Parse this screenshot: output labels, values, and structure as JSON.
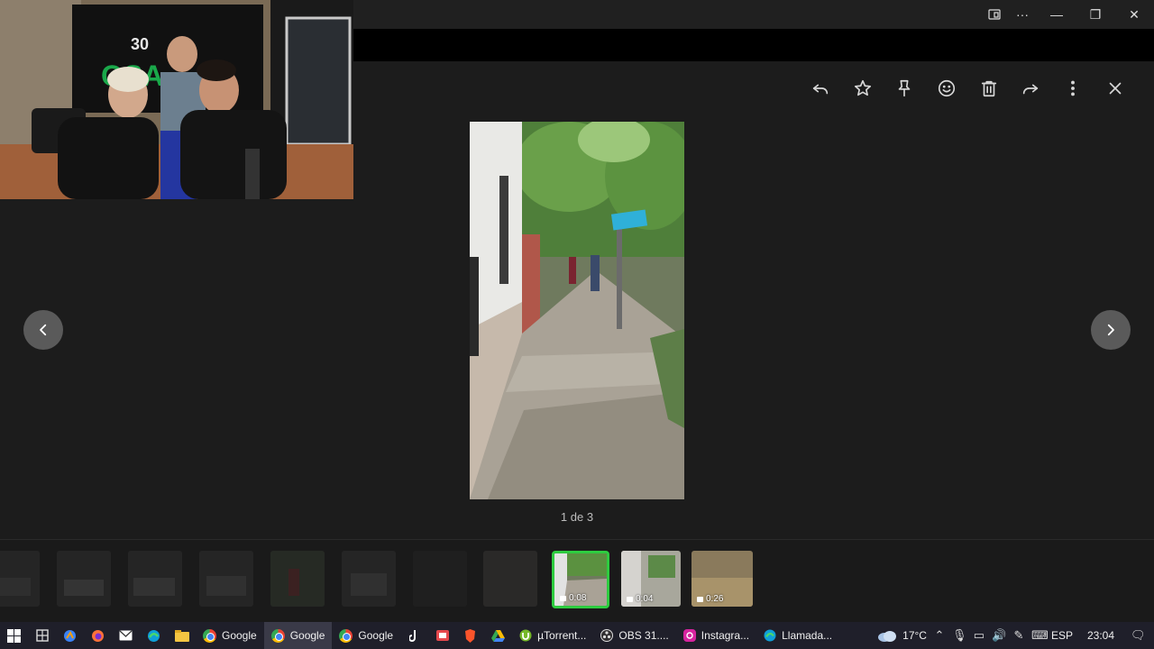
{
  "window": {
    "controls": [
      "snap-icon",
      "more-icon",
      "minimize-icon",
      "restore-icon",
      "close-icon"
    ],
    "glyphs": {
      "more": "···",
      "minimize": "—",
      "restore": "❐",
      "close": "✕"
    }
  },
  "viewer": {
    "toolbar": [
      "reply-icon",
      "star-icon",
      "pin-icon",
      "emoji-icon",
      "delete-icon",
      "forward-icon",
      "more-vertical-icon",
      "close-icon"
    ],
    "counter": "1 de 3",
    "accent": "#2ecc40"
  },
  "filmstrip": {
    "thumbs": [
      {
        "duration": ""
      },
      {
        "duration": ""
      },
      {
        "duration": ""
      },
      {
        "duration": ""
      },
      {
        "duration": ""
      },
      {
        "duration": ""
      },
      {
        "duration": ""
      },
      {
        "duration": ""
      },
      {
        "duration": "0:08",
        "selected": true
      },
      {
        "duration": "0:04"
      },
      {
        "duration": "0:26"
      }
    ]
  },
  "taskbar": {
    "apps": [
      {
        "label": "Google",
        "icon": "chrome-icon"
      },
      {
        "label": "Google",
        "icon": "chrome-icon",
        "active": true
      },
      {
        "label": "Google",
        "icon": "chrome-icon"
      },
      {
        "label": "µTorrent...",
        "icon": "utorrent-icon"
      },
      {
        "label": "OBS 31....",
        "icon": "obs-icon"
      },
      {
        "label": "Instagra...",
        "icon": "instagram-icon"
      },
      {
        "label": "Llamada...",
        "icon": "edge-icon"
      }
    ],
    "weather": "17°C",
    "language": "ESP",
    "time": "23:04"
  }
}
